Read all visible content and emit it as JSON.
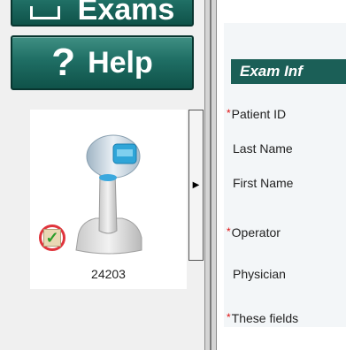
{
  "sidebar": {
    "nav": [
      {
        "label": "Exams",
        "icon": "exams-icon"
      },
      {
        "label": "Help",
        "icon": "question-mark-icon"
      }
    ],
    "device": {
      "id": "24203",
      "status_icon": "checkmark-icon",
      "status_color": "#2a9d2a",
      "highlight_color": "#e0343c"
    },
    "collapse_glyph": "▶"
  },
  "form": {
    "section_title": "Exam Inf",
    "required_marker": "*",
    "fields": [
      {
        "label": "Patient ID",
        "required": true
      },
      {
        "label": "Last Name",
        "required": false
      },
      {
        "label": "First Name",
        "required": false
      },
      {
        "label": "Operator",
        "required": true
      },
      {
        "label": "Physician",
        "required": false
      }
    ],
    "footnote": "These fields"
  },
  "colors": {
    "nav_button": "#1f6e64",
    "section_header": "#1b5f57",
    "required": "#e01010"
  }
}
